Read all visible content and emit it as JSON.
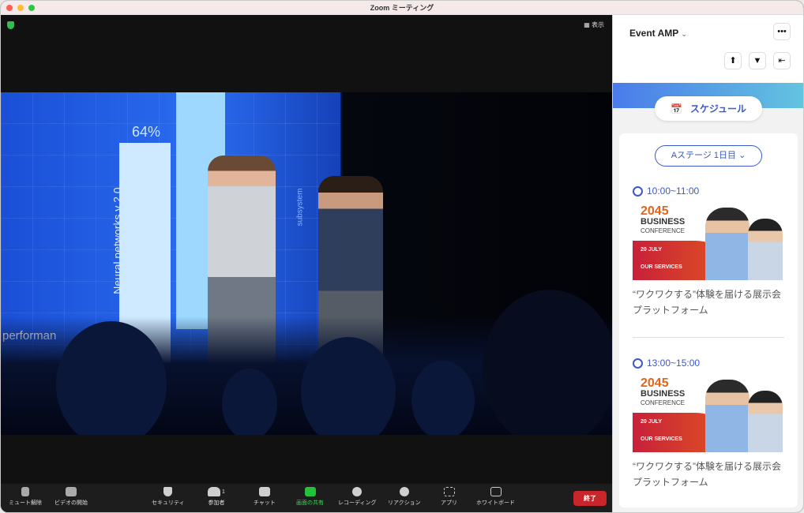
{
  "window": {
    "title": "Zoom ミーティング"
  },
  "video": {
    "view_label": "表示",
    "screen_percent": "64%",
    "screen_text_performance": "performan",
    "screen_text_neural": "Neural networks v 2.0",
    "screen_text_subsystem": "subsystem"
  },
  "toolbar": {
    "items": [
      {
        "label": "ミュート解除",
        "icon": "microphone-muted-icon"
      },
      {
        "label": "ビデオの開始",
        "icon": "video-off-icon"
      },
      {
        "label": "セキュリティ",
        "icon": "shield-icon"
      },
      {
        "label": "参加者",
        "icon": "participants-icon",
        "count": "1"
      },
      {
        "label": "チャット",
        "icon": "chat-icon"
      },
      {
        "label": "画面の共有",
        "icon": "share-screen-icon"
      },
      {
        "label": "レコーディング",
        "icon": "record-icon"
      },
      {
        "label": "リアクション",
        "icon": "reaction-icon"
      },
      {
        "label": "アプリ",
        "icon": "apps-icon"
      },
      {
        "label": "ホワイトボード",
        "icon": "whiteboard-icon"
      }
    ],
    "end_label": "終了"
  },
  "panel": {
    "title": "Event AMP",
    "schedule_label": "スケジュール",
    "stage_select": "Aステージ 1日目",
    "events": [
      {
        "time": "10:00~11:00",
        "banner": {
          "year": "2045",
          "title": "BUSINESS",
          "subtitle": "CONFERENCE",
          "date": "20 JULY",
          "services": "OUR SERVICES"
        },
        "description": "“ワクワクする”体験を届ける展示会プラットフォーム"
      },
      {
        "time": "13:00~15:00",
        "banner": {
          "year": "2045",
          "title": "BUSINESS",
          "subtitle": "CONFERENCE",
          "date": "20 JULY",
          "services": "OUR SERVICES"
        },
        "description": "“ワクワクする”体験を届ける展示会プラットフォーム"
      }
    ]
  },
  "colors": {
    "accent": "#3b59c8",
    "end": "#c8262b",
    "share": "#22c33b"
  }
}
